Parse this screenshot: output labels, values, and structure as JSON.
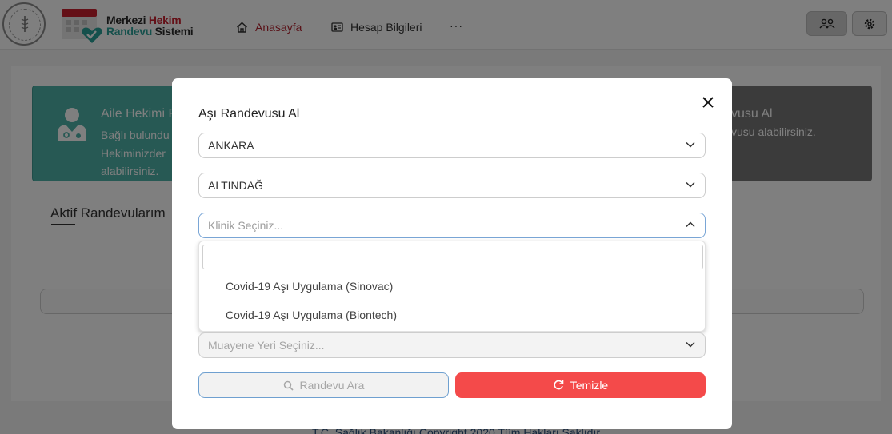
{
  "header": {
    "brand_line1_a": "Merkezi ",
    "brand_line1_b": "Hekim",
    "brand_line2_a": "Randevu",
    "brand_line2_b": " Sistemi",
    "nav": {
      "home": "Anasayfa",
      "account": "Hesap Bilgileri",
      "more": "···"
    },
    "icons": {
      "users": "users-icon",
      "settings": "gear-icon",
      "home": "home-icon",
      "account": "id-card-icon"
    }
  },
  "background": {
    "family_doctor_card": {
      "title": "Aile Hekimi R",
      "desc": "Bağlı bulundu Hekiminizder alabilirsiniz."
    },
    "vaccine_card": {
      "title": "vusu Al",
      "desc": "vusu alabilirsiniz."
    },
    "active_title": "Aktif Randevularım",
    "footer": "T.C. Sağlık Bakanlığı Copyright 2020 Tüm Hakları Saklıdır."
  },
  "modal": {
    "title": "Aşı Randevusu Al",
    "city": {
      "value": "ANKARA"
    },
    "district": {
      "value": "ALTINDAĞ"
    },
    "clinic": {
      "placeholder": "Klinik Seçiniz..."
    },
    "place": {
      "placeholder": "Muayene Yeri Seçiniz..."
    },
    "dropdown": {
      "search_value": "",
      "options": [
        "Covid-19 Aşı Uygulama (Sinovac)",
        "Covid-19 Aşı Uygulama (Biontech)"
      ]
    },
    "search_button": "Randevu Ara",
    "clear_button": "Temizle"
  },
  "colors": {
    "accent_red": "#f44a4a",
    "nav_active": "#b3232f",
    "card_green": "#4fb3a9",
    "focus_border": "#7aa6d6"
  }
}
